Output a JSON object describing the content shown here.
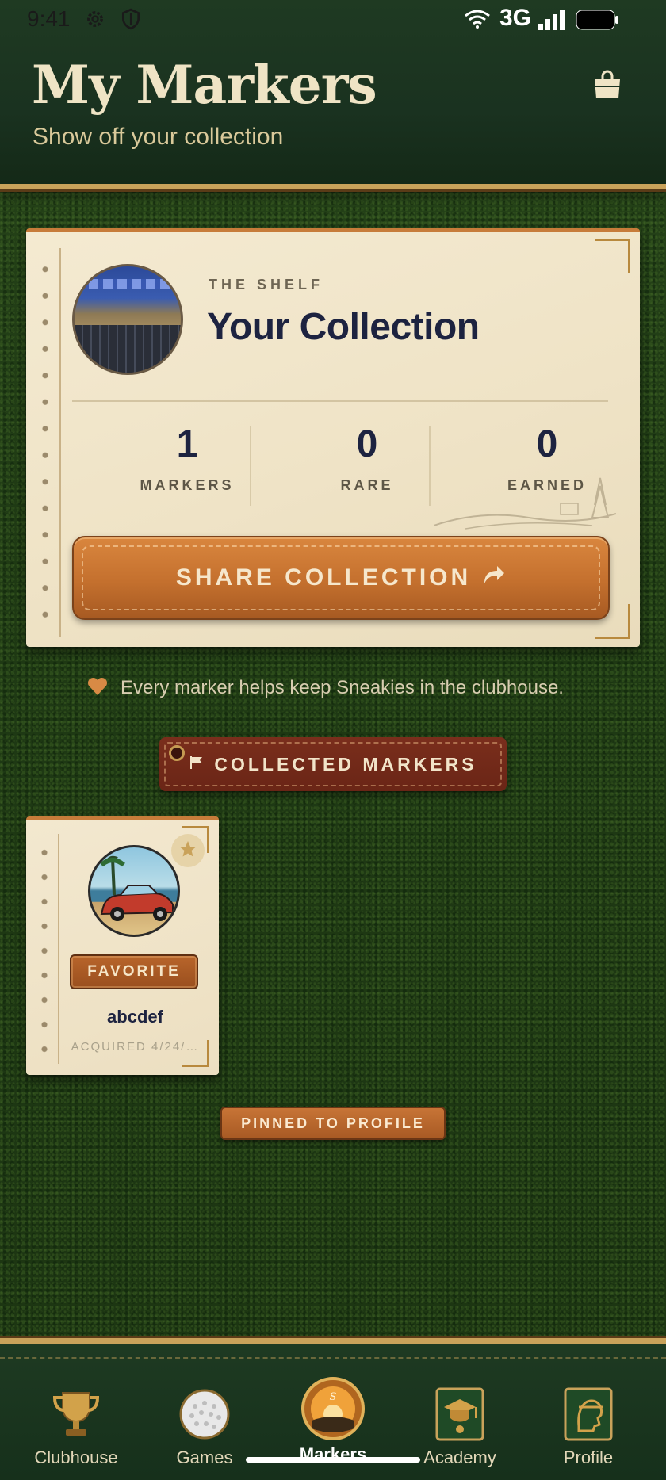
{
  "status_bar": {
    "time": "9:41",
    "network": "3G"
  },
  "header": {
    "title": "My Markers",
    "subtitle": "Show off your collection",
    "shop_icon": "shopping-bag-icon"
  },
  "collection_card": {
    "eyebrow": "THE SHELF",
    "title": "Your Collection",
    "stats": [
      {
        "value": "1",
        "label": "MARKERS"
      },
      {
        "value": "0",
        "label": "RARE"
      },
      {
        "value": "0",
        "label": "EARNED"
      }
    ],
    "share_label": "SHARE COLLECTION",
    "share_icon": "share-arrow-icon"
  },
  "support_message": "Every marker helps keep Sneakies in the clubhouse.",
  "section": {
    "label": "COLLECTED MARKERS",
    "icon": "flag-icon"
  },
  "markers": [
    {
      "name": "abcdef",
      "badge": "FAVORITE",
      "acquired": "ACQUIRED 4/24/…"
    }
  ],
  "pinned_label": "PINNED TO PROFILE",
  "nav": {
    "items": [
      {
        "label": "Clubhouse",
        "icon": "trophy-icon"
      },
      {
        "label": "Games",
        "icon": "golf-ball-icon"
      },
      {
        "label": "Markers",
        "icon": "sneakies-marker-icon"
      },
      {
        "label": "Academy",
        "icon": "graduation-cap-icon"
      },
      {
        "label": "Profile",
        "icon": "profile-head-icon"
      }
    ],
    "active": "Markers"
  },
  "colors": {
    "felt_green": "#1f3a14",
    "header_green": "#1a3220",
    "card_cream": "#f3e8cf",
    "accent_orange": "#c4702e",
    "gold_trim": "#c9a25a",
    "leather_red": "#6a2516",
    "navy_text": "#1d2340"
  }
}
